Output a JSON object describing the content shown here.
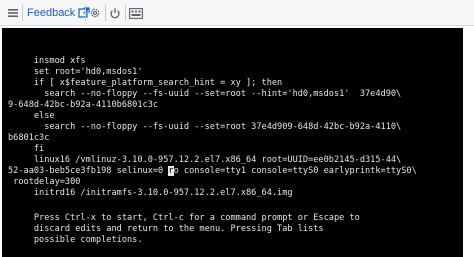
{
  "toolbar": {
    "feedback_label": "Feedback",
    "icons": [
      "external-link-icon",
      "gear-icon",
      "power-icon",
      "keyboard-icon"
    ]
  },
  "console": {
    "lines": [
      "     insmod xfs",
      "     set root='hd0,msdos1'",
      "     if [ x$feature_platform_search_hint = xy ]; then",
      "       search --no-floppy --fs-uuid --set=root --hint='hd0,msdos1'  37e4d90\\",
      "9-648d-42bc-b92a-4110b6801c3c",
      "     else",
      "       search --no-floppy --fs-uuid --set=root 37e4d909-648d-42bc-b92a-4110\\",
      "b6801c3c",
      "     fi",
      "     linux16 /vmlinuz-3.10.0-957.12.2.el7.x86_64 root=UUID=ee0b2145-d315-44\\",
      "52-aa03-beb5ce3fb198 selinux=0 ",
      "rootdelay=300",
      "     initrd16 /initramfs-3.10.0-957.12.2.el7.x86_64.img",
      "",
      "",
      "     Press Ctrl-x to start, Ctrl-c for a command prompt or Escape to",
      "     discard edits and return to the menu. Pressing Tab lists",
      "     possible completions."
    ],
    "cursor_char": "r",
    "after_cursor": "o console=tty1 console=ttyS0 earlyprintk=ttyS0\\",
    "rootdelay_prefix": " "
  }
}
